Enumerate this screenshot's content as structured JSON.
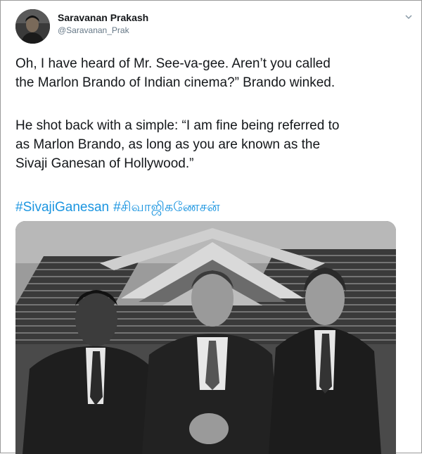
{
  "tweet": {
    "display_name": "Saravanan Prakash",
    "handle": "@Saravanan_Prak",
    "paragraph1": [
      "Oh, I have heard of Mr. See-va-gee. Aren’t you called",
      "the Marlon Brando of Indian cinema?” Brando winked."
    ],
    "paragraph2": [
      "He shot back with a simple: “I am fine being referred to",
      "as Marlon Brando, as long as you are known as the",
      "Sivaji Ganesan of Hollywood.”"
    ],
    "hashtags": [
      "#SivajiGanesan",
      "#சிவாஜிகணேசன்"
    ],
    "link_color": "#1b95e0",
    "icons": {
      "menu": "chevron-down-icon",
      "avatar": "profile-photo"
    }
  }
}
